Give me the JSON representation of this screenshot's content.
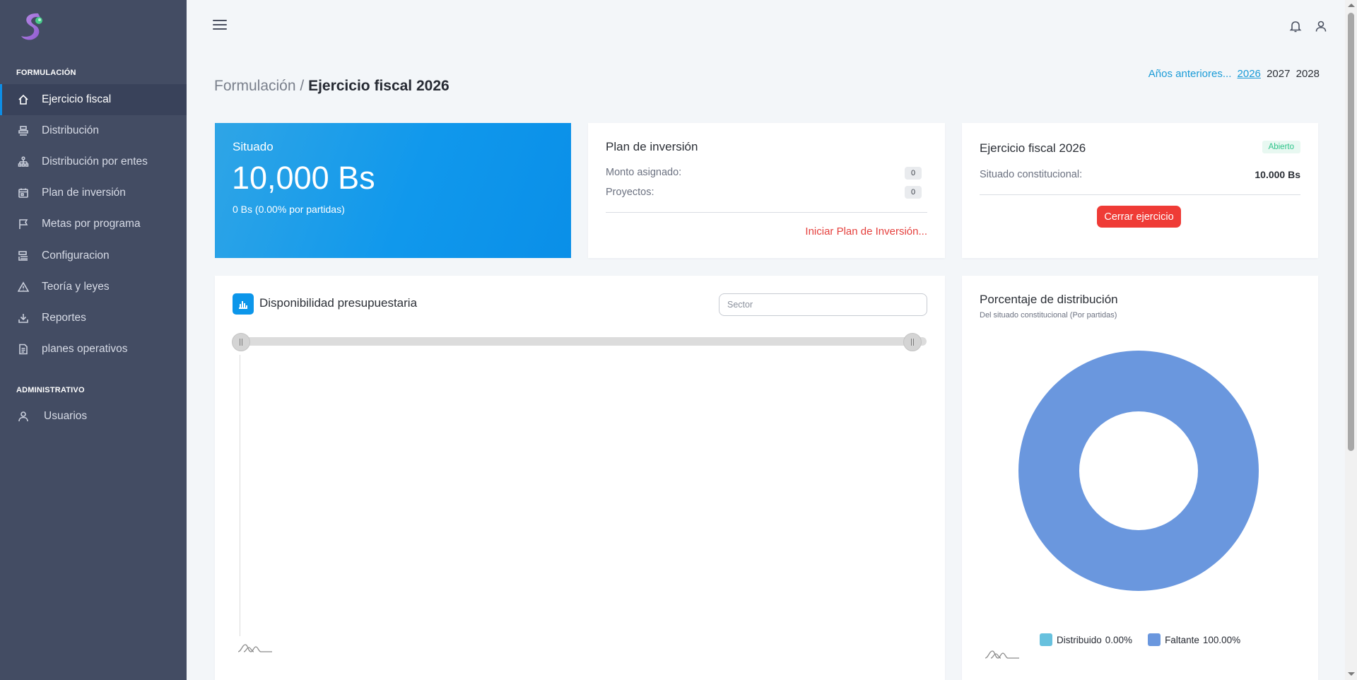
{
  "sidebar": {
    "sections": [
      {
        "title": "FORMULACIÓN",
        "items": [
          {
            "label": "Ejercicio fiscal",
            "icon": "home-icon",
            "active": true
          },
          {
            "label": "Distribución",
            "icon": "stack-icon"
          },
          {
            "label": "Distribución por entes",
            "icon": "sitemap-icon"
          },
          {
            "label": "Plan de inversión",
            "icon": "calendar-icon"
          },
          {
            "label": "Metas por programa",
            "icon": "flag-icon"
          },
          {
            "label": "Configuracion",
            "icon": "settings-list-icon"
          },
          {
            "label": "Teoría y leyes",
            "icon": "warning-icon"
          },
          {
            "label": "Reportes",
            "icon": "download-icon"
          },
          {
            "label": "planes operativos",
            "icon": "document-icon"
          }
        ]
      },
      {
        "title": "ADMINISTRATIVO",
        "items": [
          {
            "label": "Usuarios",
            "icon": "user-icon"
          }
        ]
      }
    ]
  },
  "header": {
    "menu_icon": "hamburger-icon",
    "notification_icon": "bell-icon",
    "user_icon": "user-icon"
  },
  "breadcrumb": {
    "parent": "Formulación",
    "separator": " / ",
    "current": "Ejercicio fiscal 2026"
  },
  "years": {
    "previous_label": "Años anteriores...",
    "list": [
      "2026",
      "2027",
      "2028"
    ],
    "current": "2026"
  },
  "situado_card": {
    "label": "Situado",
    "amount": "10,000 Bs",
    "sub": "0 Bs (0.00% por partidas)"
  },
  "plan_card": {
    "title": "Plan de inversión",
    "monto_label": "Monto asignado:",
    "monto_value": "0",
    "proyectos_label": "Proyectos:",
    "proyectos_value": "0",
    "link": "Iniciar Plan de Inversión..."
  },
  "fiscal_card": {
    "title": "Ejercicio fiscal 2026",
    "status": "Abierto",
    "situado_label": "Situado constitucional:",
    "situado_value": "10.000 Bs",
    "close_button": "Cerrar ejercicio"
  },
  "availability_card": {
    "title": "Disponibilidad presupuestaria",
    "icon": "bar-chart-icon",
    "sector_placeholder": "Sector",
    "sector_value": ""
  },
  "distribution_card": {
    "title": "Porcentaje de distribución",
    "subtitle": "Del situado constitucional (Por partidas)"
  },
  "chart_data": {
    "type": "pie",
    "donut": true,
    "categories": [
      "Distribuido",
      "Faltante"
    ],
    "values": [
      0.0,
      100.0
    ],
    "labels": [
      "0.00%",
      "100.00%"
    ],
    "colors": [
      "#67c1de",
      "#6a97de"
    ],
    "legend": "bottom"
  }
}
